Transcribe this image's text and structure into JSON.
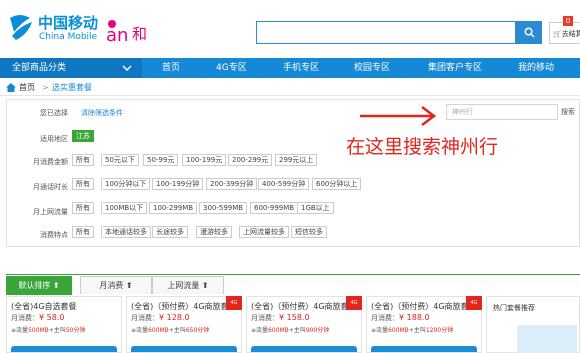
{
  "header": {
    "logo_cn": "中国移动",
    "logo_en": "China Mobile",
    "and_brand": "和",
    "search_placeholder": "",
    "cart_label": "去结算",
    "cart_count": "0"
  },
  "nav": {
    "category": "全部商品分类",
    "items": [
      "首页",
      "4G专区",
      "手机专区",
      "校园专区",
      "集团客户专区",
      "我的移动"
    ]
  },
  "breadcrumb": {
    "home": "首页",
    "current": "选实惠套餐"
  },
  "filter": {
    "selected_label": "您已选择",
    "clear_label": "清除筛选条件",
    "wizard_placeholder": "神州行",
    "wizard_button": "搜索",
    "rows": [
      {
        "label": "适用地区",
        "options": [
          "江苏"
        ]
      },
      {
        "label": "月消费金额",
        "options": [
          "所有",
          "50元以下",
          "50-99元",
          "100-199元",
          "200-299元",
          "299元以上"
        ]
      },
      {
        "label": "月通话时长",
        "options": [
          "所有",
          "100分钟以下",
          "100-199分钟",
          "200-399分钟",
          "400-599分钟",
          "600分钟以上"
        ]
      },
      {
        "label": "月上网流量",
        "options": [
          "所有",
          "100MB以下",
          "100-299MB",
          "300-599MB",
          "600-999MB",
          "1GB以上"
        ]
      },
      {
        "label": "消费特点",
        "options": [
          "所有",
          "本地通话较多",
          "长途较多",
          "漫游较多",
          "上网流量较多",
          "短信较多"
        ]
      }
    ]
  },
  "annotation": {
    "text": "在这里搜索神州行"
  },
  "sort": {
    "tabs": [
      "默认排序",
      "月消费",
      "上网流量"
    ]
  },
  "cards": [
    {
      "title": "(全省)4G自选套餐",
      "price_label": "月消费：",
      "price": "¥ 58.0",
      "desc_prefix": "≡流量",
      "desc_flow": "500MB",
      "desc_mid": "+主叫",
      "desc_call": "50分钟",
      "ribbon": ""
    },
    {
      "title": "(全省)（预付费）4G商旅套餐",
      "price_label": "月消费：",
      "price": "¥ 128.0",
      "desc_prefix": "≡流量",
      "desc_flow": "600MB",
      "desc_mid": "+主叫",
      "desc_call": "650分钟",
      "ribbon": "4G"
    },
    {
      "title": "(全省)（预付费）4G商旅套餐",
      "price_label": "月消费：",
      "price": "¥ 158.0",
      "desc_prefix": "≡流量",
      "desc_flow": "600MB",
      "desc_mid": "+主叫",
      "desc_call": "900分钟",
      "ribbon": "4G"
    },
    {
      "title": "(全省)（预付费）4G商旅套餐",
      "price_label": "月消费：",
      "price": "¥ 188.0",
      "desc_prefix": "≡流量",
      "desc_flow": "600MB",
      "desc_mid": "+主叫",
      "desc_call": "1200分钟",
      "ribbon": "4G"
    }
  ],
  "hot": {
    "title": "热门套餐推荐"
  },
  "colors": {
    "brand_blue": "#1589d6",
    "accent_green": "#3aa63a",
    "price_red": "#e0261d"
  }
}
